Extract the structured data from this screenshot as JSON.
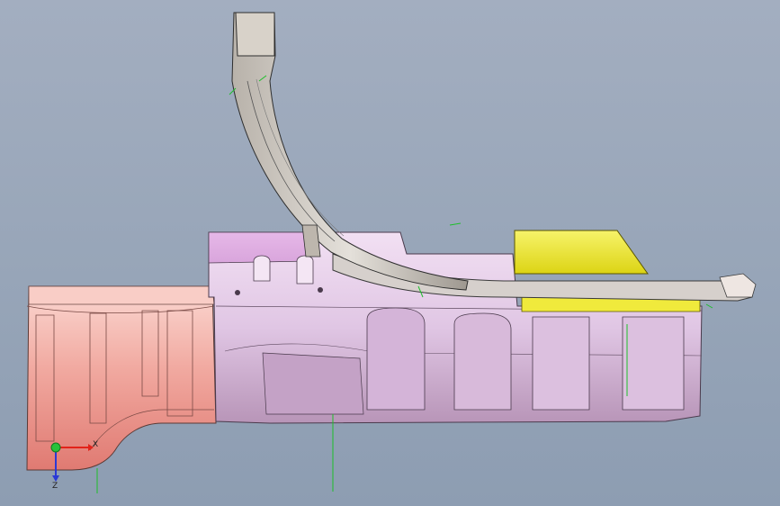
{
  "viewport": {
    "background_top": "#a3aec0",
    "background_bottom": "#8d9db2"
  },
  "colors": {
    "salmon_part": "#f1a9a0",
    "lilac_part": "#e3c9e6",
    "yellow_part": "#f3ee38",
    "grey_part": "#c9c4bd",
    "edge": "#3a3a3a",
    "green_marker": "#1dbf2a"
  },
  "triad": {
    "x_label": "X",
    "z_label": "Z",
    "x_color": "#e2231a",
    "y_color": "#27c23a",
    "z_color": "#2a39d6"
  }
}
